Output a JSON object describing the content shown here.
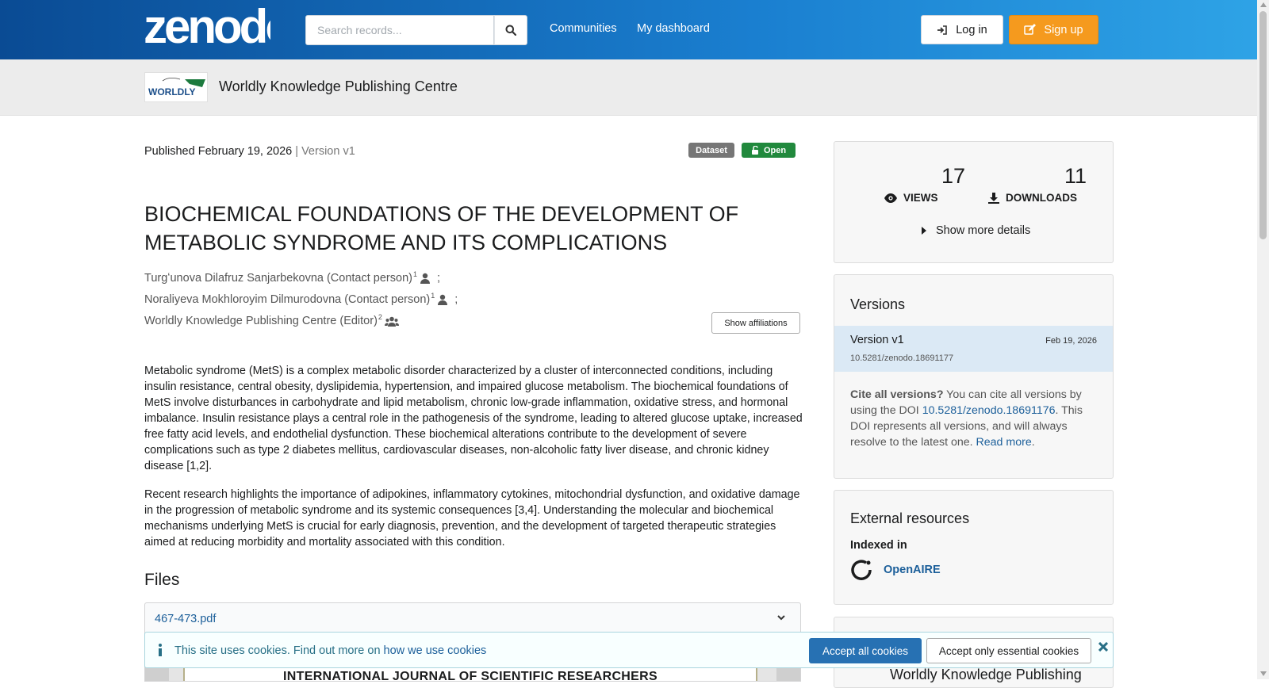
{
  "header": {
    "logo_text": "zenodo",
    "search_placeholder": "Search records...",
    "nav": [
      "Communities",
      "My dashboard"
    ],
    "login_label": "Log in",
    "signup_label": "Sign up"
  },
  "community": {
    "logo_text": "WORLDLY",
    "name": "Worldly Knowledge Publishing Centre"
  },
  "record": {
    "published": "Published February 19, 2026",
    "version_sep": "|",
    "version": "Version v1",
    "badge_type": "Dataset",
    "badge_access": "Open",
    "title": "BIOCHEMICAL FOUNDATIONS OF THE DEVELOPMENT OF METABOLIC SYNDROME AND ITS COMPLICATIONS",
    "creators": [
      {
        "name": "Turgʻunova Dilafruz Sanjarbekovna (Contact person)",
        "affil": "1",
        "sep": ";"
      },
      {
        "name": "Noraliyeva Mokhloroyim Dilmurodovna (Contact person)",
        "affil": "1",
        "sep": ";"
      },
      {
        "name": "Worldly Knowledge Publishing Centre (Editor)",
        "affil": "2",
        "sep": ""
      }
    ],
    "show_affiliations": "Show affiliations",
    "abstract": [
      "Metabolic syndrome (MetS) is a complex metabolic disorder characterized by a cluster of interconnected conditions, including insulin resistance, central obesity, dyslipidemia, hypertension, and impaired glucose metabolism. The biochemical foundations of MetS involve disturbances in carbohydrate and lipid metabolism, chronic low-grade inflammation, oxidative stress, and hormonal imbalance. Insulin resistance plays a central role in the pathogenesis of the syndrome, leading to altered glucose uptake, increased free fatty acid levels, and endothelial dysfunction. These biochemical alterations contribute to the development of severe complications such as type 2 diabetes mellitus, cardiovascular diseases, non-alcoholic fatty liver disease, and chronic kidney disease [1,2].",
      "Recent research highlights the importance of adipokines, inflammatory cytokines, mitochondrial dysfunction, and oxidative damage in the progression of metabolic syndrome and its systemic consequences [3,4]. Understanding the molecular and biochemical mechanisms underlying MetS is crucial for early diagnosis, prevention, and the development of targeted therapeutic strategies aimed at reducing morbidity and mortality associated with this condition."
    ],
    "files_heading": "Files",
    "file_name": "467-473.pdf",
    "preview_text": "INTERNATIONAL JOURNAL OF SCIENTIFIC RESEARCHERS"
  },
  "stats": {
    "views_count": "17",
    "views_label": "VIEWS",
    "downloads_count": "11",
    "downloads_label": "DOWNLOADS",
    "more_details": "Show more details"
  },
  "versions": {
    "heading": "Versions",
    "current_name": "Version v1",
    "current_doi": "10.5281/zenodo.18691177",
    "current_date": "Feb 19, 2026",
    "cite_bold": "Cite all versions?",
    "cite_text_1": " You can cite all versions by using the DOI ",
    "cite_doi": "10.5281/zenodo.18691176",
    "cite_text_2": ". This DOI represents all versions, and will always resolve to the latest one. ",
    "read_more": "Read more",
    "cite_end": "."
  },
  "external": {
    "heading": "External resources",
    "indexed_label": "Indexed in",
    "openaire": "OpenAIRE"
  },
  "next_card": {
    "partial_text": "Worldly Knowledge Publishing"
  },
  "cookie": {
    "text": "This site uses cookies. Find out more on ",
    "link": "how we use cookies",
    "accept_all": "Accept all cookies",
    "accept_essential": "Accept only essential cookies"
  },
  "colors": {
    "header_start": "#0a4b94",
    "header_end": "#2ea3e6",
    "signup": "#f59a1e",
    "open_badge": "#21893d",
    "link": "#1c5f9a",
    "accept_all": "#2771b3"
  }
}
